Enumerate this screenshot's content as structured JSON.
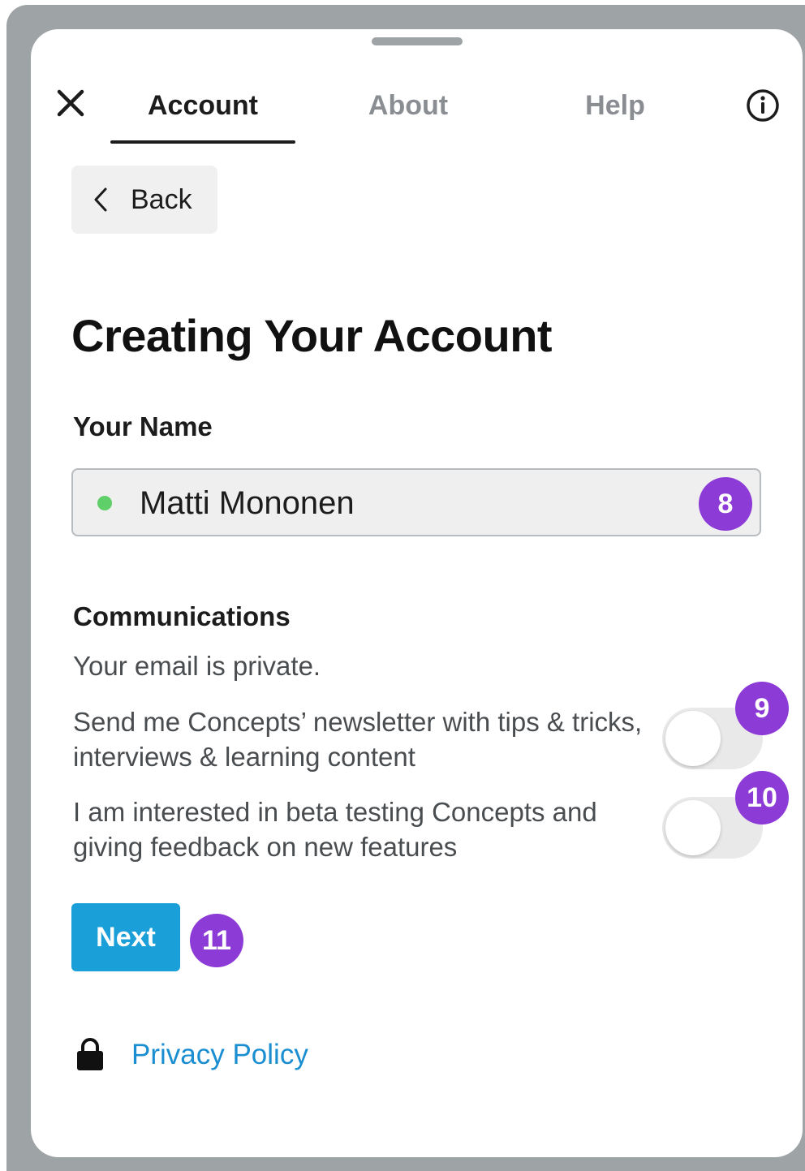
{
  "tabs": [
    {
      "label": "Account",
      "active": true
    },
    {
      "label": "About",
      "active": false
    },
    {
      "label": "Help",
      "active": false
    }
  ],
  "icons": {
    "close": "close-icon",
    "info": "info-icon",
    "back": "chevron-left-icon",
    "lock": "lock-icon"
  },
  "back_label": "Back",
  "page_title": "Creating Your Account",
  "name_section": {
    "label": "Your Name",
    "value": "Matti Mononen",
    "status_color": "#5fcf6a"
  },
  "communications": {
    "title": "Communications",
    "subtitle": "Your email is private.",
    "options": [
      {
        "text": "Send me Concepts’ newsletter with tips & tricks, interviews & learning content",
        "enabled": false
      },
      {
        "text": "I am interested in beta testing Concepts and giving feedback on new features",
        "enabled": false
      }
    ]
  },
  "next_label": "Next",
  "privacy_label": "Privacy Policy",
  "annotation_badges": [
    "8",
    "9",
    "10",
    "11"
  ],
  "colors": {
    "accent": "#1a9fd8",
    "link": "#1a8ed0",
    "badge": "#8d3bd6"
  }
}
